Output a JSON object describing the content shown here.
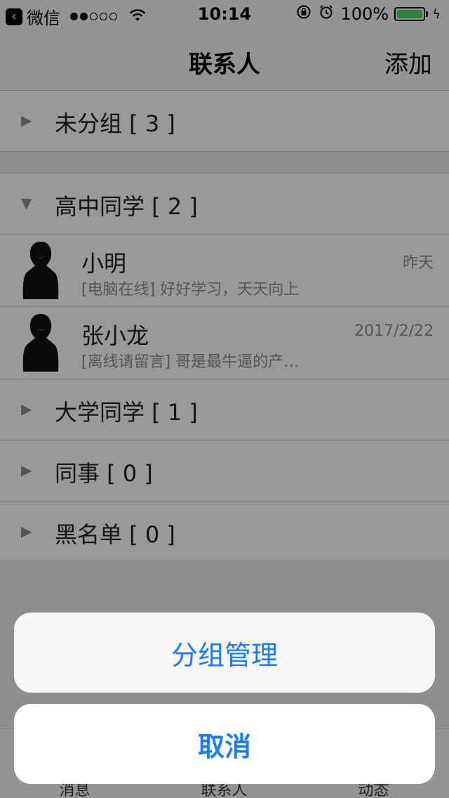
{
  "status_bar": {
    "back_app": "微信",
    "time": "10:14",
    "battery_percent": "100%",
    "signal_bars_filled": 2,
    "signal_bars_total": 5,
    "battery_level": 1.0,
    "battery_color": "#4cd964"
  },
  "nav": {
    "title": "联系人",
    "add": "添加"
  },
  "groups_top": [
    {
      "title": "未分组 [ 3 ]",
      "arrow": "▶",
      "expanded": false
    }
  ],
  "group_open": {
    "title": "高中同学 [ 2 ]",
    "arrow": "▼",
    "expanded": true
  },
  "contacts": [
    {
      "name": "小明",
      "status": "[电脑在线] 好好学习，天天向上",
      "time": "昨天"
    },
    {
      "name": "张小龙",
      "status": "[离线请留言] 哥是最牛逼的产…",
      "time": "2017/2/22"
    }
  ],
  "groups_bottom": [
    {
      "title": "大学同学 [ 1 ]",
      "arrow": "▶",
      "expanded": false
    },
    {
      "title": "同事 [ 0 ]",
      "arrow": "▶",
      "expanded": false
    },
    {
      "title": "黑名单 [ 0 ]",
      "arrow": "▶",
      "expanded": false
    }
  ],
  "tab_bar": {
    "tabs": [
      "消息",
      "联系人",
      "动态"
    ]
  },
  "action_sheet": {
    "primary": "分组管理",
    "cancel": "取消",
    "accent": "#1a7cff"
  }
}
